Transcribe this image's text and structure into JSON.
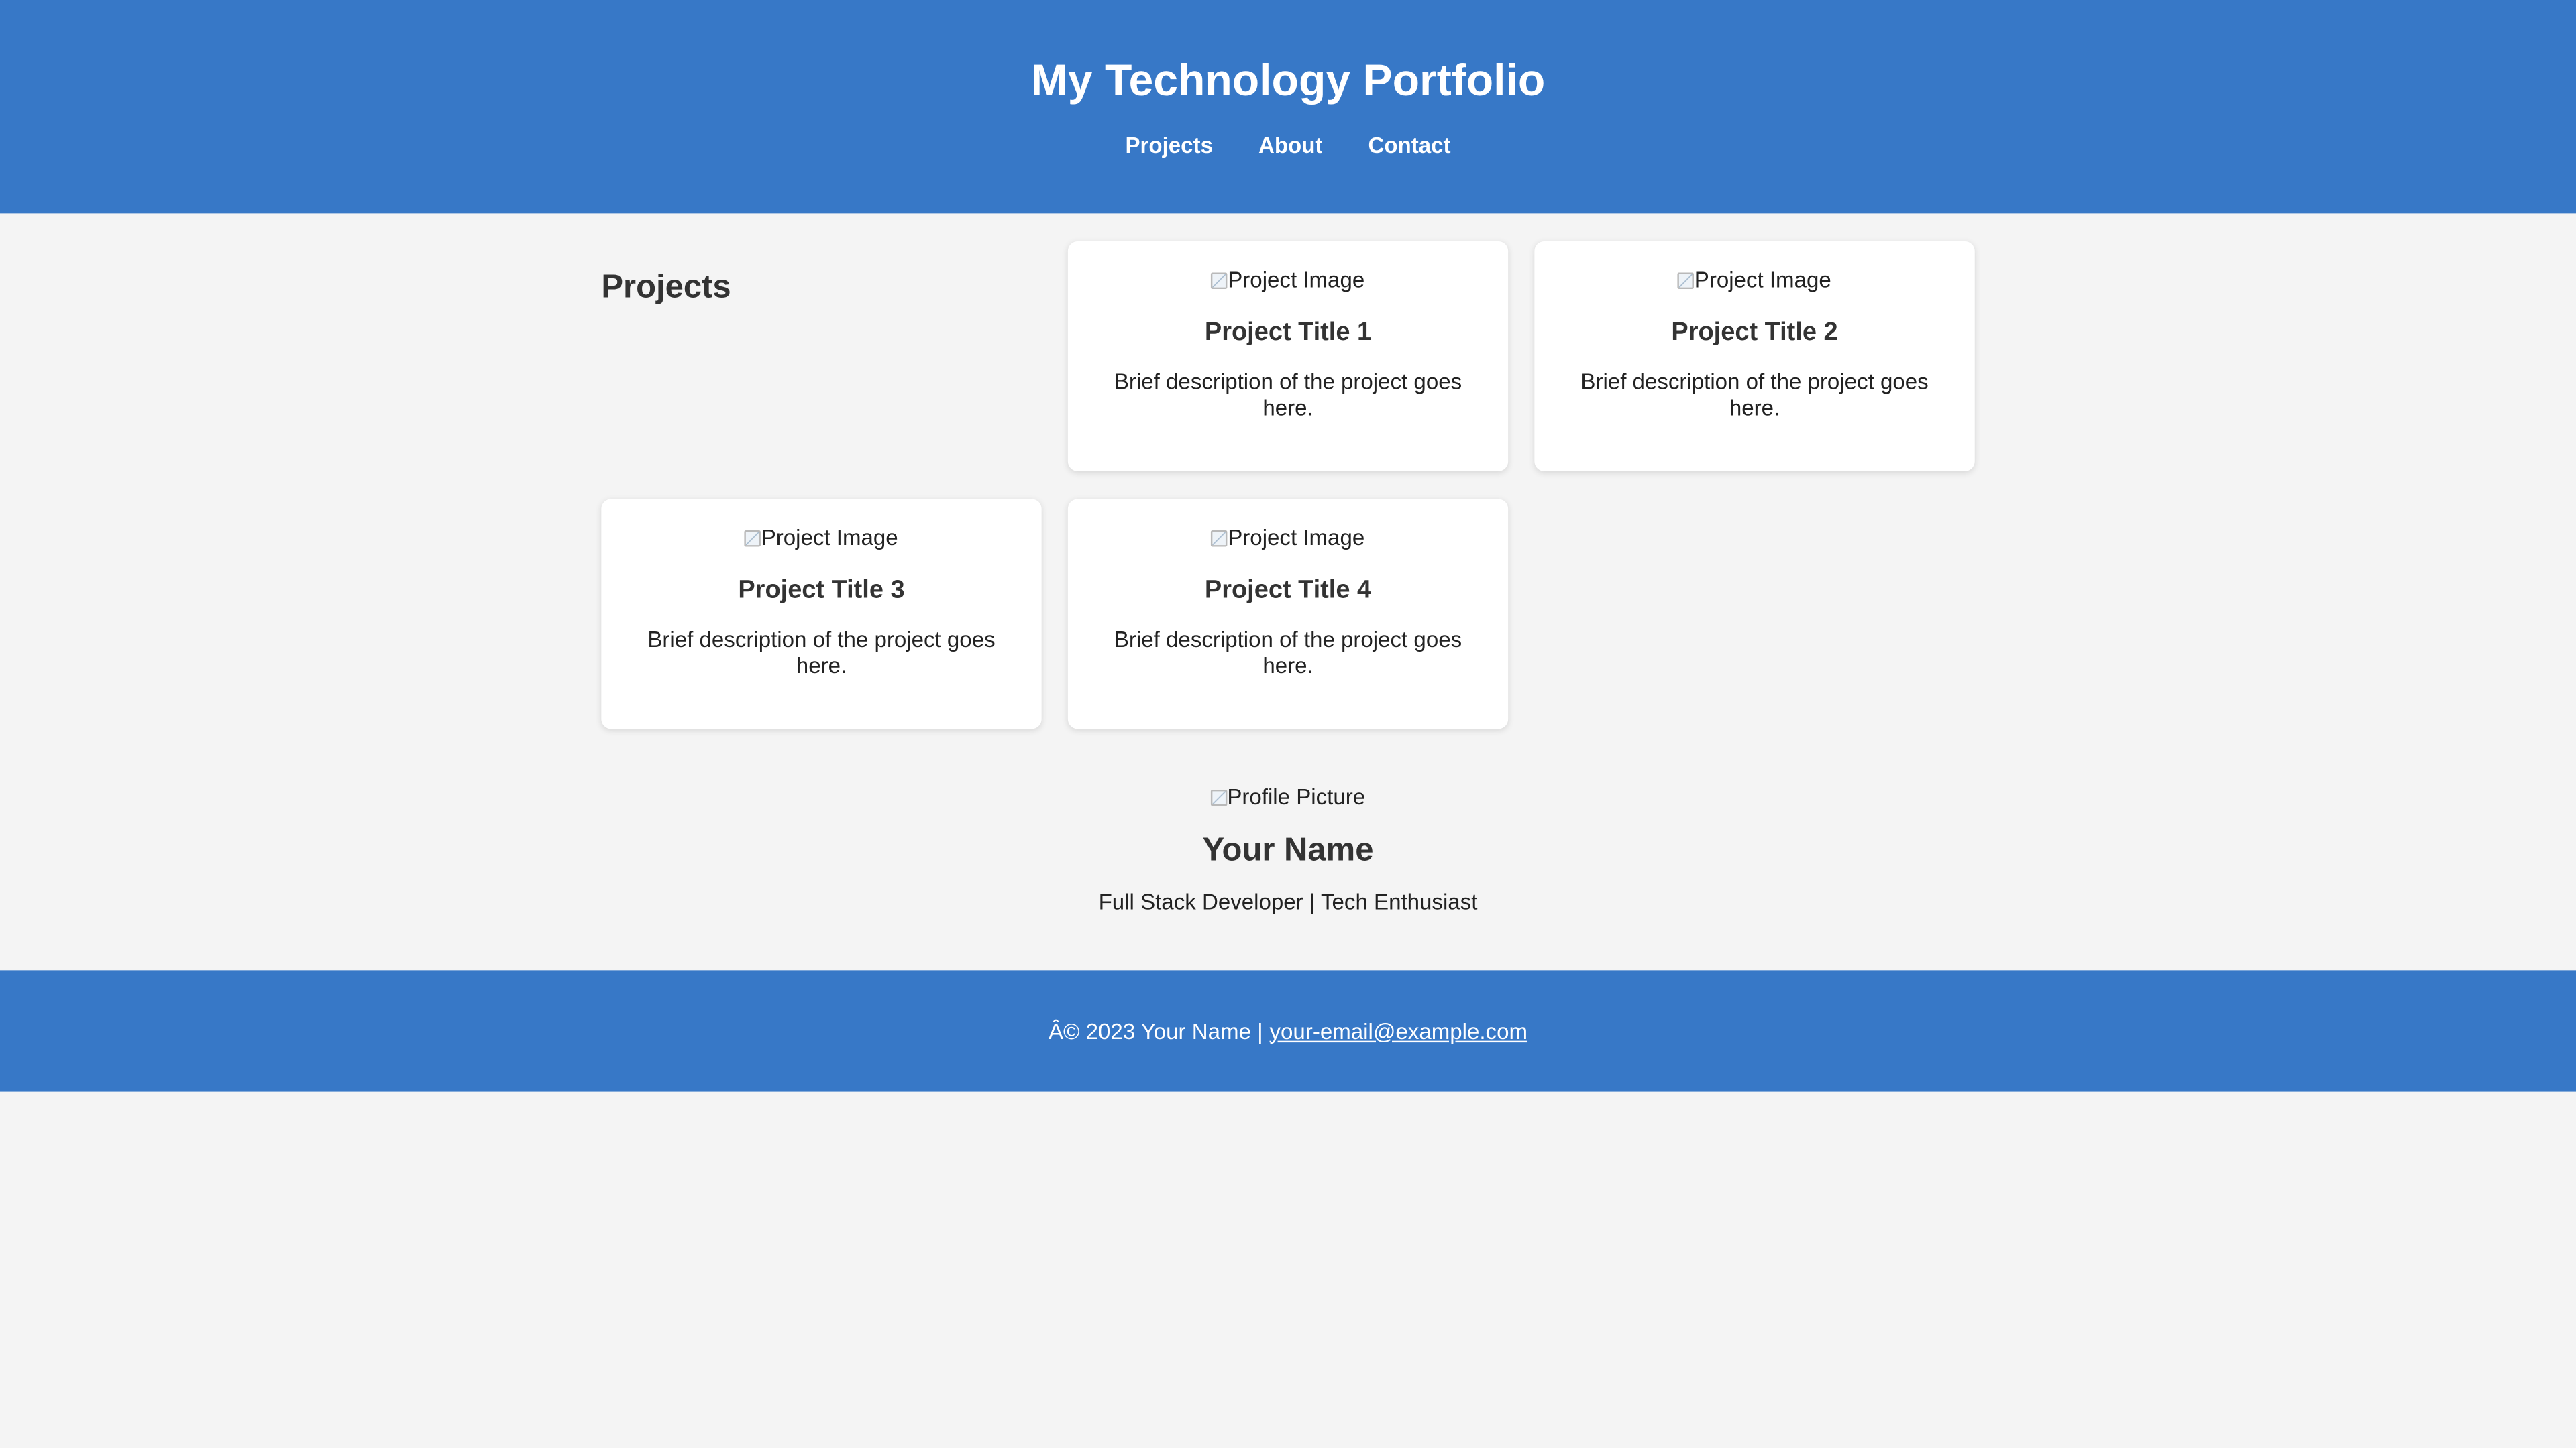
{
  "header": {
    "title": "My Technology Portfolio",
    "nav": [
      {
        "label": "Projects"
      },
      {
        "label": "About"
      },
      {
        "label": "Contact"
      }
    ]
  },
  "projects": {
    "section_title": "Projects",
    "items": [
      {
        "image_alt": "Project Image",
        "title": "Project Title 1",
        "description": "Brief description of the project goes here."
      },
      {
        "image_alt": "Project Image",
        "title": "Project Title 2",
        "description": "Brief description of the project goes here."
      },
      {
        "image_alt": "Project Image",
        "title": "Project Title 3",
        "description": "Brief description of the project goes here."
      },
      {
        "image_alt": "Project Image",
        "title": "Project Title 4",
        "description": "Brief description of the project goes here."
      }
    ]
  },
  "profile": {
    "image_alt": "Profile Picture",
    "name": "Your Name",
    "tagline": "Full Stack Developer | Tech Enthusiast"
  },
  "footer": {
    "copyright": "Â© 2023 Your Name |",
    "email": "your-email@example.com"
  },
  "colors": {
    "header_bg": "#3778c7",
    "page_bg": "#f4f4f4",
    "card_bg": "#ffffff"
  }
}
